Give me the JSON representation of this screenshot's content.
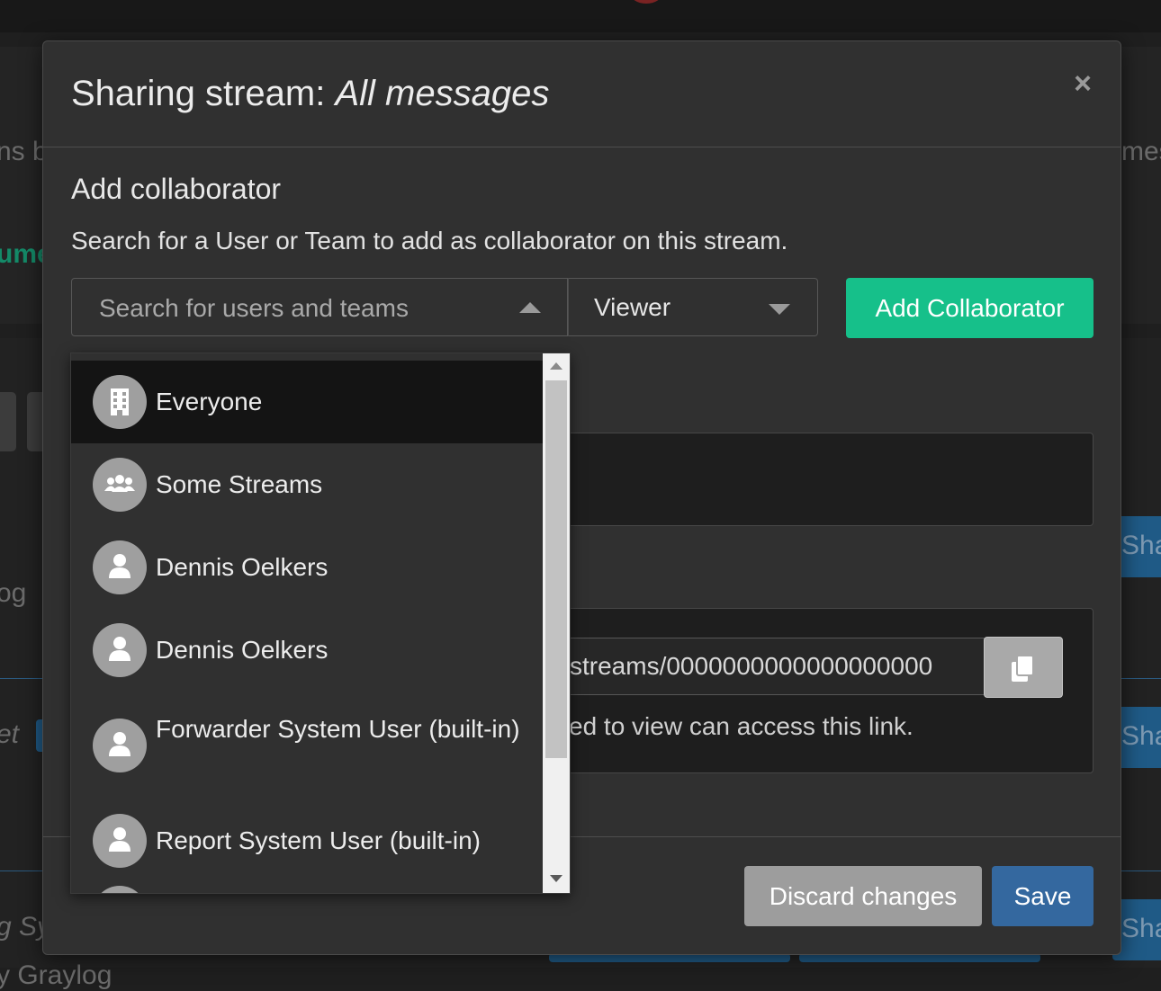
{
  "background": {
    "fragments": [
      "ns by",
      "mes",
      "ume",
      "og",
      "et",
      "Shar",
      "Shar",
      "Shar",
      "g Sys",
      "y Graylog"
    ]
  },
  "modal": {
    "title_prefix": "Sharing stream: ",
    "title_entity": "All messages",
    "close_icon": "close-icon",
    "section_title": "Add collaborator",
    "section_description": "Search for a User or Team to add as collaborator on this stream.",
    "search": {
      "placeholder": "Search for users and teams",
      "value": ""
    },
    "role_select": {
      "selected": "Viewer"
    },
    "add_button_label": "Add Collaborator",
    "share_link": {
      "value": "streams/0000000000000000000",
      "help_text": "ed to view can access this link.",
      "copy_icon": "copy-icon"
    },
    "footer": {
      "discard_label": "Discard changes",
      "save_label": "Save"
    }
  },
  "dropdown": {
    "options": [
      {
        "label": "Everyone",
        "icon": "building-icon",
        "active": true
      },
      {
        "label": "Some Streams",
        "icon": "team-icon",
        "active": false
      },
      {
        "label": "Dennis Oelkers",
        "icon": "user-icon",
        "active": false
      },
      {
        "label": "Dennis Oelkers",
        "icon": "user-icon",
        "active": false
      },
      {
        "label": "Forwarder System User (built-in)",
        "icon": "user-icon",
        "active": false
      },
      {
        "label": "Report System User (built-in)",
        "icon": "user-icon",
        "active": false
      }
    ]
  },
  "colors": {
    "accent_green": "#16c08a",
    "primary_blue": "#34689f",
    "modal_bg": "#303030",
    "discard_gray": "#9d9d9d"
  }
}
